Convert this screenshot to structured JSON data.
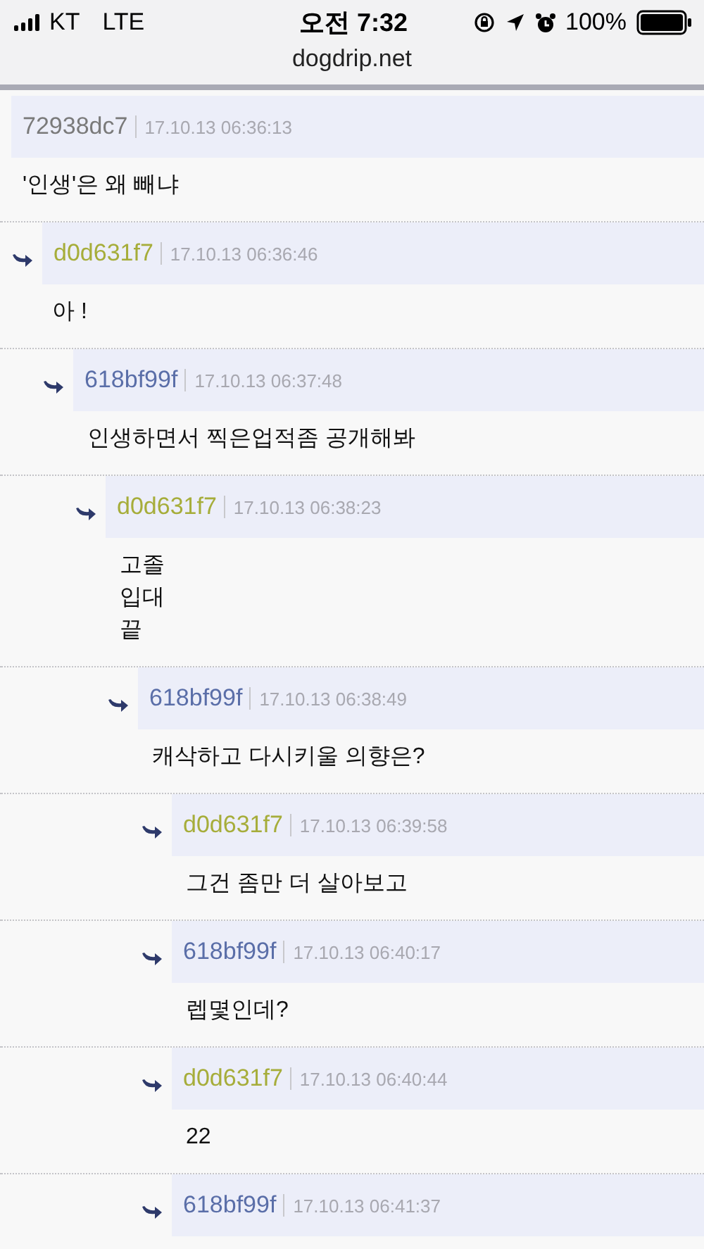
{
  "status_bar": {
    "carrier": "KT",
    "network": "LTE",
    "time": "오전 7:32",
    "battery": "100%"
  },
  "address_bar": {
    "url": "dogdrip.net"
  },
  "comments": [
    {
      "author": "72938dc7",
      "color": "#7a7a7a",
      "date": "17.10.13 06:36:13",
      "text": "'인생'은 왜 빼냐",
      "children": [
        {
          "author": "d0d631f7",
          "color": "#a6ad3a",
          "date": "17.10.13 06:36:46",
          "text": "아 !",
          "children": [
            {
              "author": "618bf99f",
              "color": "#5a6ea8",
              "date": "17.10.13 06:37:48",
              "text": "인생하면서 찍은업적좀 공개해봐",
              "children": [
                {
                  "author": "d0d631f7",
                  "color": "#a6ad3a",
                  "date": "17.10.13 06:38:23",
                  "text": "고졸\n입대\n끝",
                  "children": [
                    {
                      "author": "618bf99f",
                      "color": "#5a6ea8",
                      "date": "17.10.13 06:38:49",
                      "text": "캐삭하고 다시키울 의향은?",
                      "children": [
                        {
                          "author": "d0d631f7",
                          "color": "#a6ad3a",
                          "date": "17.10.13 06:39:58",
                          "text": "그건 좀만 더 살아보고",
                          "children": [
                            {
                              "author": "618bf99f",
                              "color": "#5a6ea8",
                              "date": "17.10.13 06:40:17",
                              "text": "렙몇인데?",
                              "children": [
                                {
                                  "author": "d0d631f7",
                                  "color": "#a6ad3a",
                                  "date": "17.10.13 06:40:44",
                                  "text": "22",
                                  "children": [
                                    {
                                      "author": "618bf99f",
                                      "color": "#5a6ea8",
                                      "date": "17.10.13 06:41:37"
                                    }
                                  ]
                                }
                              ]
                            }
                          ]
                        }
                      ]
                    }
                  ]
                }
              ]
            }
          ]
        }
      ]
    }
  ]
}
